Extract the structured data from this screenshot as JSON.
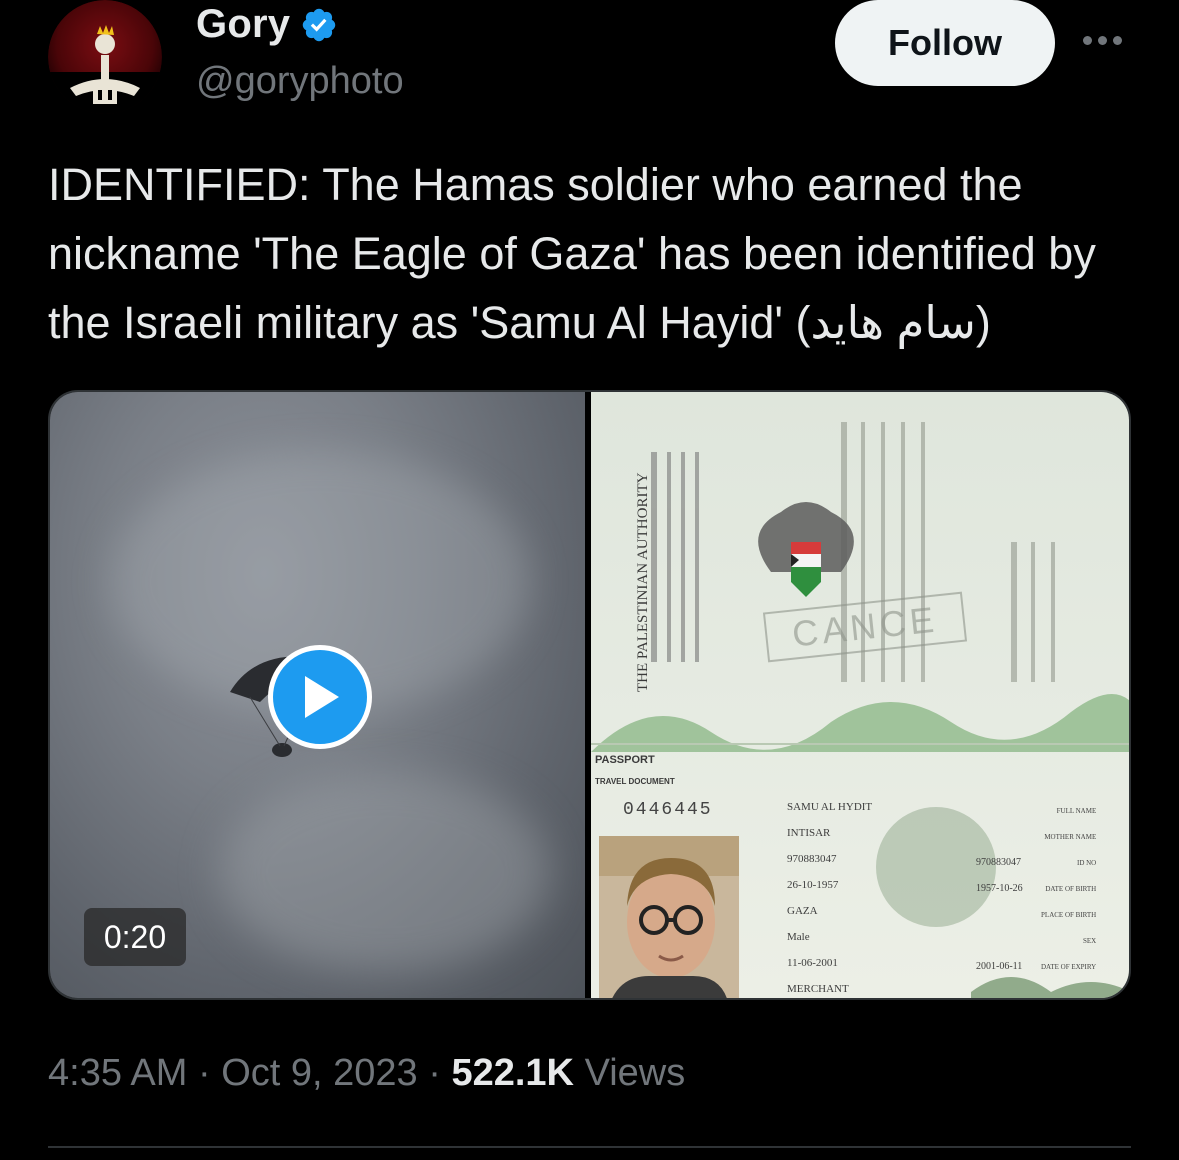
{
  "author": {
    "display_name": "Gory",
    "handle": "@goryphoto",
    "verified": true
  },
  "actions": {
    "follow_label": "Follow"
  },
  "tweet": {
    "text": "IDENTIFIED: The Hamas soldier who earned the nickname 'The Eagle of Gaza' has been identified by the Israeli military as 'Samu Al Hayid' (سام هايد)"
  },
  "media": {
    "video_duration": "0:20",
    "passport": {
      "authority_en": "THE PALESTINIAN AUTHORITY",
      "stamp": "CANCE",
      "label_passport": "PASSPORT",
      "label_travel": "TRAVEL DOCUMENT",
      "number": "0446445",
      "full_name": "SAMU AL HYDIT",
      "mother_name": "INTISAR",
      "id_no": "970883047",
      "dob": "26-10-1957",
      "place_of_birth": "GAZA",
      "sex": "Male",
      "expiry": "11-06-2001",
      "profession": "MERCHANT",
      "id_no_right": "970883047",
      "dob_right": "1957-10-26",
      "expiry_right": "2001-06-11",
      "label_full_name": "FULL NAME",
      "label_mother_name": "MOTHER NAME",
      "label_id": "ID NO",
      "label_dob": "DATE OF BIRTH",
      "label_pob": "PLACE OF BIRTH",
      "label_sex": "SEX",
      "label_expiry": "DATE OF EXPIRY"
    }
  },
  "footer": {
    "time": "4:35 AM",
    "date": "Oct 9, 2023",
    "views_count": "522.1K",
    "views_label": "Views",
    "separator": "·"
  },
  "colors": {
    "background": "#000000",
    "text_primary": "#e7e9ea",
    "text_secondary": "#71767b",
    "accent_blue": "#1d9bf0",
    "follow_bg": "#eff3f4"
  },
  "icons": {
    "verified": "verified-badge-icon",
    "more": "more-horizontal-icon",
    "play": "play-icon"
  }
}
